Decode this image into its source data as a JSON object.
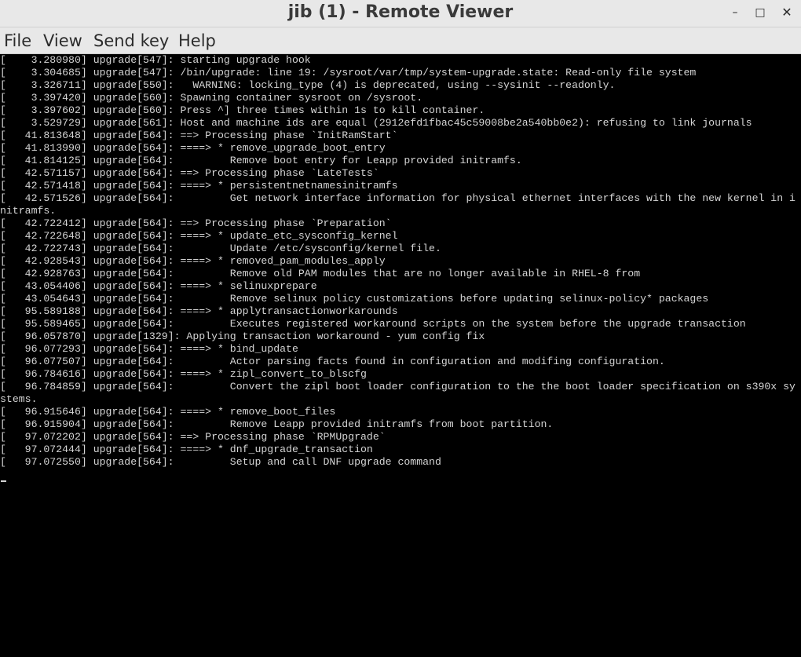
{
  "window": {
    "title": "jib (1) - Remote Viewer",
    "controls": {
      "minimize": "–",
      "maximize": "□",
      "close": "✕"
    }
  },
  "menu": {
    "file": "File",
    "view": "View",
    "send_key": "Send key",
    "help": "Help"
  },
  "console": {
    "lines": [
      "[    3.280980] upgrade[547]: starting upgrade hook",
      "[    3.304685] upgrade[547]: /bin/upgrade: line 19: /sysroot/var/tmp/system-upgrade.state: Read-only file system",
      "[    3.326711] upgrade[550]:   WARNING: locking_type (4) is deprecated, using --sysinit --readonly.",
      "[    3.397420] upgrade[560]: Spawning container sysroot on /sysroot.",
      "[    3.397602] upgrade[560]: Press ^] three times within 1s to kill container.",
      "[    3.529729] upgrade[561]: Host and machine ids are equal (2912efd1fbac45c59008be2a540bb0e2): refusing to link journals",
      "[   41.813648] upgrade[564]: ==> Processing phase `InitRamStart`",
      "[   41.813990] upgrade[564]: ====> * remove_upgrade_boot_entry",
      "[   41.814125] upgrade[564]:         Remove boot entry for Leapp provided initramfs.",
      "[   42.571157] upgrade[564]: ==> Processing phase `LateTests`",
      "[   42.571418] upgrade[564]: ====> * persistentnetnamesinitramfs",
      "[   42.571526] upgrade[564]:         Get network interface information for physical ethernet interfaces with the new kernel in i",
      "nitramfs.",
      "[   42.722412] upgrade[564]: ==> Processing phase `Preparation`",
      "[   42.722648] upgrade[564]: ====> * update_etc_sysconfig_kernel",
      "[   42.722743] upgrade[564]:         Update /etc/sysconfig/kernel file.",
      "[   42.928543] upgrade[564]: ====> * removed_pam_modules_apply",
      "[   42.928763] upgrade[564]:         Remove old PAM modules that are no longer available in RHEL-8 from",
      "[   43.054406] upgrade[564]: ====> * selinuxprepare",
      "[   43.054643] upgrade[564]:         Remove selinux policy customizations before updating selinux-policy* packages",
      "[   95.589188] upgrade[564]: ====> * applytransactionworkarounds",
      "[   95.589465] upgrade[564]:         Executes registered workaround scripts on the system before the upgrade transaction",
      "[   96.057870] upgrade[1329]: Applying transaction workaround - yum config fix",
      "[   96.077293] upgrade[564]: ====> * bind_update",
      "[   96.077507] upgrade[564]:         Actor parsing facts found in configuration and modifing configuration.",
      "[   96.784616] upgrade[564]: ====> * zipl_convert_to_blscfg",
      "[   96.784859] upgrade[564]:         Convert the zipl boot loader configuration to the the boot loader specification on s390x sy",
      "stems.",
      "[   96.915646] upgrade[564]: ====> * remove_boot_files",
      "[   96.915904] upgrade[564]:         Remove Leapp provided initramfs from boot partition.",
      "[   97.072202] upgrade[564]: ==> Processing phase `RPMUpgrade`",
      "[   97.072444] upgrade[564]: ====> * dnf_upgrade_transaction",
      "[   97.072550] upgrade[564]:         Setup and call DNF upgrade command"
    ]
  }
}
